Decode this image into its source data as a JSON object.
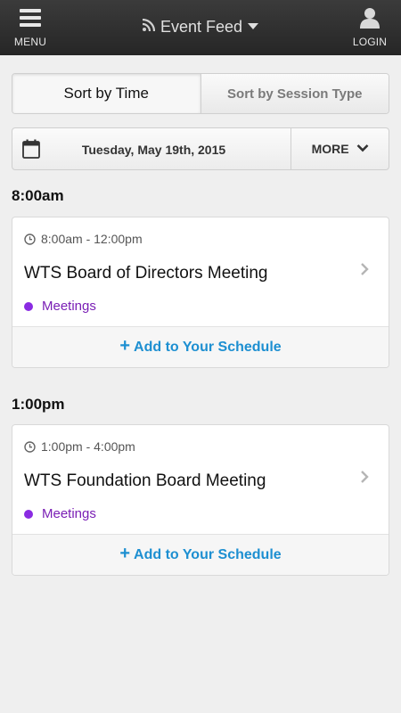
{
  "topbar": {
    "menu_label": "MENU",
    "title": "Event Feed",
    "login_label": "LOGIN"
  },
  "sort": {
    "tabs": [
      {
        "label": "Sort by Time",
        "active": true
      },
      {
        "label": "Sort by Session Type",
        "active": false
      }
    ]
  },
  "datebar": {
    "date": "Tuesday, May 19th, 2015",
    "more_label": "MORE"
  },
  "groups": [
    {
      "time_header": "8:00am",
      "event": {
        "time_range": "8:00am - 12:00pm",
        "title": "WTS Board of Directors Meeting",
        "category": "Meetings",
        "add_label": "Add to Your Schedule"
      }
    },
    {
      "time_header": "1:00pm",
      "event": {
        "time_range": "1:00pm - 4:00pm",
        "title": "WTS Foundation Board Meeting",
        "category": "Meetings",
        "add_label": "Add to Your Schedule"
      }
    }
  ],
  "colors": {
    "accent": "#1d8fd1",
    "category": "#8a2be2",
    "topbar": "#2e2e2e"
  },
  "icons": [
    "menu-icon",
    "rss-icon",
    "dropdown-caret-icon",
    "user-icon",
    "calendar-icon",
    "chevron-down-icon",
    "clock-icon",
    "chevron-right-icon",
    "plus-icon"
  ]
}
